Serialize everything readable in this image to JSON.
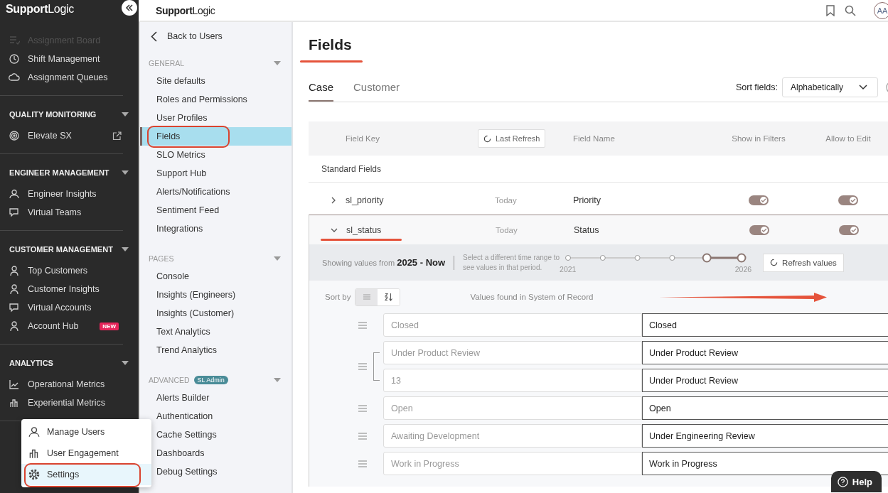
{
  "sidebar": {
    "logo": {
      "strong": "Support",
      "light": "Logic"
    },
    "sections": [
      {
        "items": [
          {
            "label": "Assignment Board",
            "external": false
          },
          {
            "label": "Shift Management",
            "external": false
          },
          {
            "label": "Assignment Queues",
            "external": false
          }
        ]
      },
      {
        "title": "QUALITY MONITORING",
        "items": [
          {
            "label": "Elevate SX",
            "external": true
          }
        ]
      },
      {
        "title": "ENGINEER MANAGEMENT",
        "items": [
          {
            "label": "Engineer Insights",
            "external": false
          },
          {
            "label": "Virtual Teams",
            "external": false
          }
        ]
      },
      {
        "title": "CUSTOMER MANAGEMENT",
        "items": [
          {
            "label": "Top Customers",
            "external": false
          },
          {
            "label": "Customer Insights",
            "external": false
          },
          {
            "label": "Virtual Accounts",
            "external": false
          },
          {
            "label": "Account Hub",
            "external": false,
            "badge": "NEW"
          }
        ]
      },
      {
        "title": "ANALYTICS",
        "items": [
          {
            "label": "Operational Metrics",
            "external": false
          },
          {
            "label": "Experiential Metrics",
            "external": false
          }
        ]
      }
    ]
  },
  "popup_menu": {
    "items": [
      {
        "label": "Manage Users",
        "selected": false
      },
      {
        "label": "User Engagement",
        "selected": false
      },
      {
        "label": "Settings",
        "selected": true
      }
    ]
  },
  "header": {
    "logo": {
      "strong": "Support",
      "light": "Logic"
    },
    "avatar": "AA"
  },
  "settings_nav": {
    "back": "Back to Users",
    "groups": [
      {
        "title": "GENERAL",
        "items": [
          {
            "label": "Site defaults",
            "selected": false
          },
          {
            "label": "Roles and Permissions",
            "selected": false
          },
          {
            "label": "User Profiles",
            "selected": false
          },
          {
            "label": "Fields",
            "selected": true
          },
          {
            "label": "SLO Metrics",
            "selected": false
          },
          {
            "label": "Support Hub",
            "selected": false
          },
          {
            "label": "Alerts/Notifications",
            "selected": false
          },
          {
            "label": "Sentiment Feed",
            "selected": false
          },
          {
            "label": "Integrations",
            "selected": false
          }
        ]
      },
      {
        "title": "PAGES",
        "items": [
          {
            "label": "Console",
            "selected": false
          },
          {
            "label": "Insights (Engineers)",
            "selected": false
          },
          {
            "label": "Insights (Customer)",
            "selected": false
          },
          {
            "label": "Text Analytics",
            "selected": false
          },
          {
            "label": "Trend Analytics",
            "selected": false
          }
        ]
      },
      {
        "title": "ADVANCED",
        "badge": "SL Admin",
        "items": [
          {
            "label": "Alerts Builder",
            "selected": false
          },
          {
            "label": "Authentication",
            "selected": false
          },
          {
            "label": "Cache Settings",
            "selected": false
          },
          {
            "label": "Dashboards",
            "selected": false
          },
          {
            "label": "Debug Settings",
            "selected": false
          }
        ]
      }
    ]
  },
  "page": {
    "title": "Fields",
    "tabs": [
      {
        "label": "Case",
        "selected": true
      },
      {
        "label": "Customer",
        "selected": false
      }
    ],
    "sort": {
      "label": "Sort fields:",
      "value": "Alphabetically"
    },
    "table": {
      "columns": {
        "key": "Field Key",
        "refresh": "Last Refresh",
        "name": "Field Name",
        "filters": "Show in Filters",
        "edit": "Allow to Edit"
      },
      "group": "Standard Fields",
      "rows": [
        {
          "key": "sl_priority",
          "last_refresh": "Today",
          "name": "Priority",
          "show_in_filters": true,
          "allow_edit": true,
          "expanded": false
        },
        {
          "key": "sl_status",
          "last_refresh": "Today",
          "name": "Status",
          "show_in_filters": true,
          "allow_edit": true,
          "expanded": true,
          "values_panel": {
            "range_label": "Showing values from",
            "range_value": "2025 - Now",
            "hint": "Select a different time range to see values in that period.",
            "stops": [
              {
                "label": "2021",
                "selected": false
              },
              {
                "selected": false
              },
              {
                "selected": false
              },
              {
                "selected": false
              },
              {
                "selected": true
              },
              {
                "label": "2026",
                "selected": true
              }
            ],
            "refresh": "Refresh values",
            "sort_label": "Sort by",
            "sort_modes": [
              {
                "selected": true
              },
              {
                "selected": false
              }
            ],
            "column": "Values found in System of Record",
            "mappings": [
              {
                "values": [
                  {
                    "source": "Closed",
                    "label": "Closed"
                  }
                ]
              },
              {
                "values": [
                  {
                    "source": "Under Product Review",
                    "label": "Under Product Review"
                  },
                  {
                    "source": "13",
                    "label": "Under Product Review"
                  }
                ]
              },
              {
                "values": [
                  {
                    "source": "Open",
                    "label": "Open"
                  }
                ]
              },
              {
                "values": [
                  {
                    "source": "Awaiting Development",
                    "label": "Under Engineering Review"
                  }
                ]
              },
              {
                "values": [
                  {
                    "source": "Work in Progress",
                    "label": "Work in Progress"
                  }
                ]
              }
            ]
          }
        }
      ]
    }
  },
  "help": "Help"
}
